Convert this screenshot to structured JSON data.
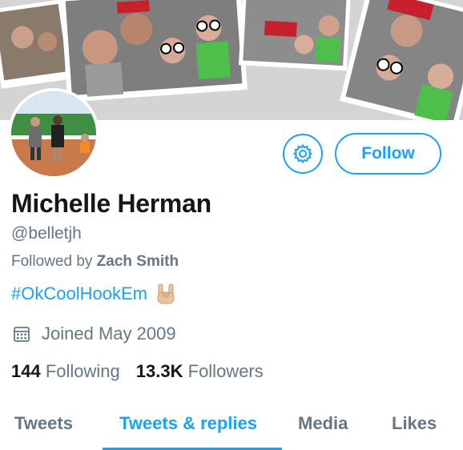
{
  "profile": {
    "display_name": "Michelle Herman",
    "handle": "@belletjh",
    "followed_by_prefix": "Followed by",
    "followed_by_name": "Zach Smith",
    "bio_hashtag": "#OkCoolHookEm",
    "bio_emoji": "rock-on-hand-emoji",
    "joined": "Joined May 2009",
    "following_count": "144",
    "following_label": "Following",
    "followers_count": "13.3K",
    "followers_label": "Followers"
  },
  "actions": {
    "settings_icon": "gear-icon",
    "follow_label": "Follow"
  },
  "tabs": [
    {
      "label": "Tweets",
      "active": false
    },
    {
      "label": "Tweets & replies",
      "active": true
    },
    {
      "label": "Media",
      "active": false
    },
    {
      "label": "Likes",
      "active": false
    }
  ],
  "colors": {
    "accent": "#1da1f2",
    "text_primary": "#14171a",
    "text_secondary": "#657786"
  }
}
